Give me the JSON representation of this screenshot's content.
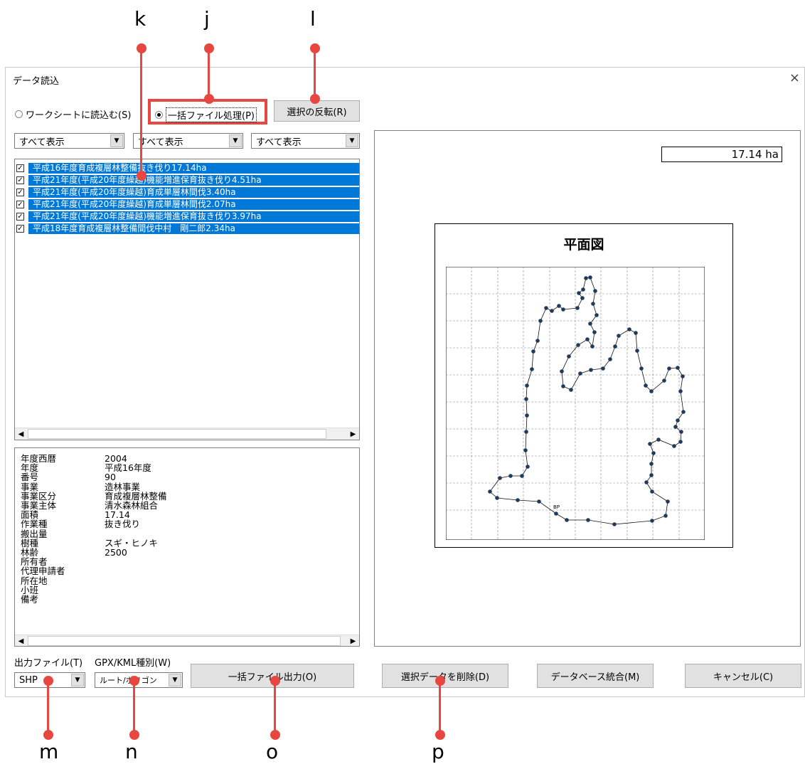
{
  "callouts": [
    {
      "letter": "k"
    },
    {
      "letter": "j"
    },
    {
      "letter": "l"
    },
    {
      "letter": "m"
    },
    {
      "letter": "n"
    },
    {
      "letter": "o"
    },
    {
      "letter": "p"
    }
  ],
  "dialog": {
    "title": "データ読込",
    "close_glyph": "×",
    "radio_worksheet": "ワークシートに読込む(S)",
    "radio_batch": "一括ファイル処理(P)",
    "invert_button": "選択の反転(R)",
    "filters": [
      "すべて表示",
      "すべて表示",
      "すべて表示"
    ],
    "list_items": [
      "平成16年度育成複層林整備抜き伐り17.14ha",
      "平成21年度(平成20年度繰越)機能増進保育抜き伐り4.51ha",
      "平成21年度(平成20年度繰越)育成単層林間伐3.40ha",
      "平成21年度(平成20年度繰越)育成単層林間伐2.07ha",
      "平成21年度(平成20年度繰越)機能増進保育抜き伐り3.97ha",
      "平成18年度育成複層林整備間伐中村　剛二郎2.34ha"
    ],
    "details": [
      {
        "k": "年度西暦",
        "v": "2004"
      },
      {
        "k": "年度",
        "v": "平成16年度"
      },
      {
        "k": "番号",
        "v": "90"
      },
      {
        "k": "事業",
        "v": "造林事業"
      },
      {
        "k": "事業区分",
        "v": "育成複層林整備"
      },
      {
        "k": "事業主体",
        "v": "清水森林組合"
      },
      {
        "k": "面積",
        "v": "17.14"
      },
      {
        "k": "作業種",
        "v": "抜き伐り"
      },
      {
        "k": "搬出量",
        "v": ""
      },
      {
        "k": "樹種",
        "v": "スギ・ヒノキ"
      },
      {
        "k": "林齢",
        "v": "2500"
      },
      {
        "k": "所有者",
        "v": ""
      },
      {
        "k": "代理申請者",
        "v": ""
      },
      {
        "k": "所在地",
        "v": ""
      },
      {
        "k": "小班",
        "v": ""
      },
      {
        "k": "備考",
        "v": ""
      }
    ],
    "area_value": "17.14 ha",
    "chart_title": "平面図",
    "bp_label": "BP",
    "output_file_label": "出力ファイル(T)",
    "gpx_label": "GPX/KML種別(W)",
    "output_file_value": "SHP",
    "gpx_value": "ルート/ポリゴン",
    "batch_output_button": "一括ファイル出力(O)",
    "delete_button": "選択データを削除(D)",
    "db_merge_button": "データベース統合(M)",
    "cancel_button": "キャンセル(C)"
  },
  "colors": {
    "callout": "#e8473f",
    "selection": "#0078d7",
    "plot_point": "#1f3a5a"
  }
}
